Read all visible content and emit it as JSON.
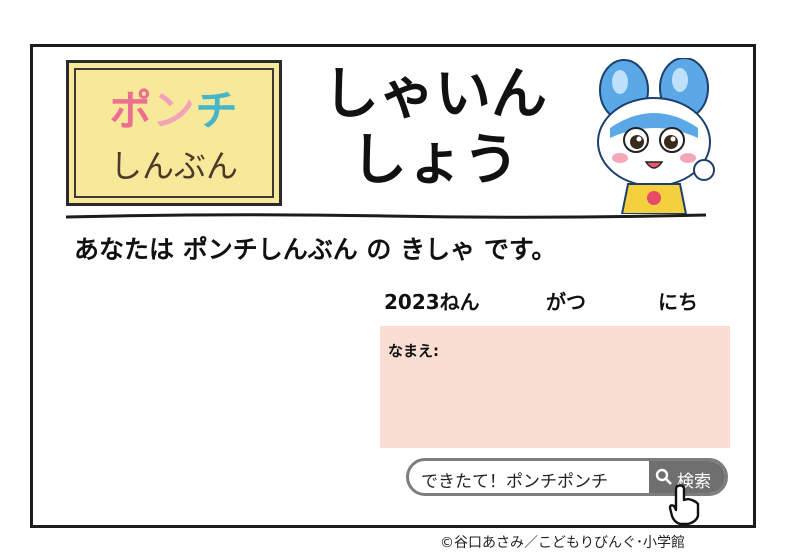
{
  "logo": {
    "line1": [
      "ポ",
      "ン",
      "チ",
      ""
    ],
    "line2": "しんぶん"
  },
  "title": {
    "line1": "しゃいん",
    "line2": "しょう"
  },
  "intro": "あなたは ポンチしんぶん の きしゃ です。",
  "date": {
    "year": "2023ねん",
    "month": "がつ",
    "day": "にち"
  },
  "name_label": "なまえ:",
  "search": {
    "text": "できたて！ポンチポンチ",
    "button": "検索",
    "icon": "magnifier-icon"
  },
  "credit": "©谷口あさみ／こどもりびんぐ･小学館",
  "colors": {
    "name_box": "#fbded3",
    "logo_bg": "#f8e89a",
    "search_button": "#6f6f6f"
  }
}
